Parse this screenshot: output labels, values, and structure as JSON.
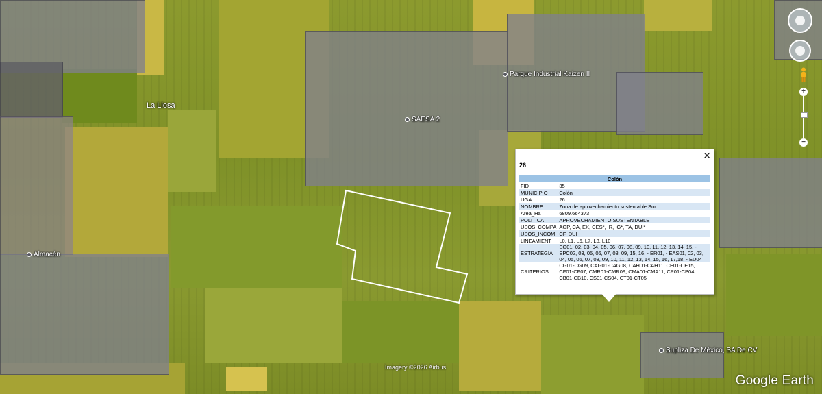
{
  "map": {
    "places": [
      {
        "label": "Parque Industrial Kaizen II"
      },
      {
        "label": "SAESA 2"
      },
      {
        "label": "Almacén"
      },
      {
        "label": "Supliza De México, SA De CV"
      }
    ],
    "town": "La Llosa",
    "imagery_credit": "Imagery ©2026 Airbus",
    "brand": "Google Earth"
  },
  "controls": {
    "look_icon": "look-around-icon",
    "move_icon": "move-icon",
    "pegman_icon": "street-view-pegman-icon",
    "zoom_in": "+",
    "zoom_out": "−"
  },
  "balloon": {
    "title": "26",
    "close": "✕",
    "header": "Colón",
    "rows": [
      {
        "key": "FID",
        "value": "35"
      },
      {
        "key": "MUNICIPIO",
        "value": "Colón"
      },
      {
        "key": "UGA",
        "value": "26"
      },
      {
        "key": "NOMBRE",
        "value": "Zona de aprovechamiento sustentable Sur"
      },
      {
        "key": "Area_Ha",
        "value": "6809.664373"
      },
      {
        "key": "POLITICA",
        "value": "APROVECHAMIENTO SUSTENTABLE"
      },
      {
        "key": "USOS_COMPA",
        "value": "AGP, CA, EX, CES*, IR, IG*, TA, DUI*"
      },
      {
        "key": "USOS_INCOM",
        "value": "CF, DUI"
      },
      {
        "key": "LINEAMIENT",
        "value": "L0, L1, L6, L7, L8, L10"
      },
      {
        "key": "ESTRATEGIA",
        "value": "EG01, 02, 03, 04, 05, 06, 07, 08, 09, 10, 11, 12, 13, 14, 15, - EPC02, 03, 05, 06, 07, 08, 09, 15, 16, - ER01, - EAS01, 02, 03, 04, 05, 06, 07, 08, 09, 10, 11, 12, 13, 14, 15, 16, 17,18, - EU04"
      },
      {
        "key": "CRITERIOS",
        "value": "CG01-CG09, CAG01-CAG08, CAH01-CAH11, CE01-CE15, CF01-CF07, CMR01-CMR09, CMA01-CMA11, CP01-CP04, CB01-CB10, CS01-CS04, CT01-CT05"
      }
    ]
  }
}
